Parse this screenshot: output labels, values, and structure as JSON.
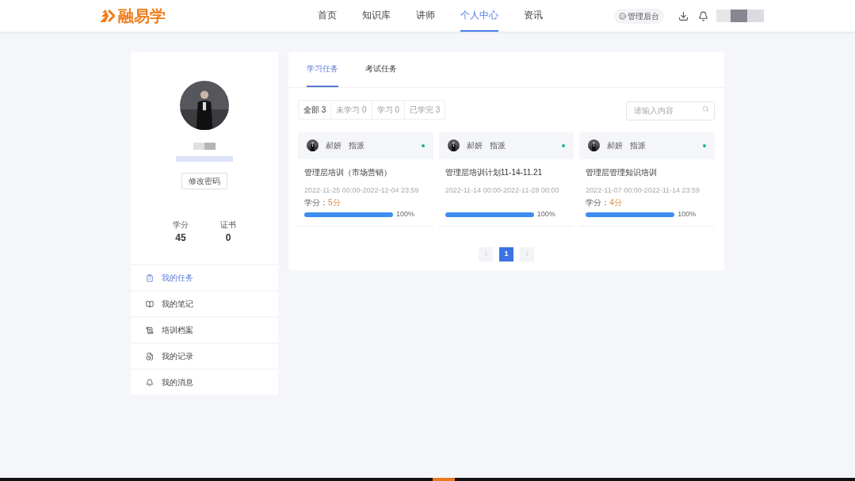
{
  "header": {
    "logo": "融易学",
    "nav": [
      {
        "label": "首页",
        "selected": false
      },
      {
        "label": "知识库",
        "selected": false
      },
      {
        "label": "讲师",
        "selected": false
      },
      {
        "label": "个人中心",
        "selected": true
      },
      {
        "label": "资讯",
        "selected": false
      }
    ],
    "admin_button": "管理后台"
  },
  "profile": {
    "change_password": "修改密码",
    "stats": [
      {
        "label": "学分",
        "value": "45"
      },
      {
        "label": "证书",
        "value": "0"
      }
    ]
  },
  "menu": [
    {
      "label": "我的任务",
      "selected": true
    },
    {
      "label": "我的笔记",
      "selected": false
    },
    {
      "label": "培训档案",
      "selected": false
    },
    {
      "label": "我的记录",
      "selected": false
    },
    {
      "label": "我的消息",
      "selected": false
    }
  ],
  "tabs": [
    {
      "label": "学习任务",
      "selected": true
    },
    {
      "label": "考试任务",
      "selected": false
    }
  ],
  "filters": [
    {
      "label": "全部 3",
      "selected": true
    },
    {
      "label": "未学习 0",
      "selected": false
    },
    {
      "label": "学习 0",
      "selected": false
    },
    {
      "label": "已学完 3",
      "selected": false
    }
  ],
  "search": {
    "placeholder": "请输入内容"
  },
  "tasks": [
    {
      "assigner": "郝妍",
      "action": "指派",
      "color": "#1bb394",
      "title": "管理层培训（市场营销）",
      "period": "2022-11-25 00:00-2022-12-04 23:59",
      "credit_label": "学分：",
      "credit": "5分",
      "level": 1,
      "percent": "100%"
    },
    {
      "assigner": "郝妍",
      "action": "指派",
      "color": "#1bb394",
      "title": "管理层培训计划11-14-11.21",
      "period": "2022-11-14 00:00-2022-11-28 00:00",
      "level": 1,
      "percent": "100%"
    },
    {
      "assigner": "郝妍",
      "action": "指派",
      "color": "#1bb394",
      "title": "管理层管理知识培训",
      "period": "2022-11-07 00:00-2022-11-14 23:59",
      "credit_label": "学分：",
      "credit": "4分",
      "level": 1,
      "percent": "100%"
    }
  ],
  "pagination": {
    "pages": [
      {
        "label": "1",
        "selected": true
      }
    ]
  }
}
